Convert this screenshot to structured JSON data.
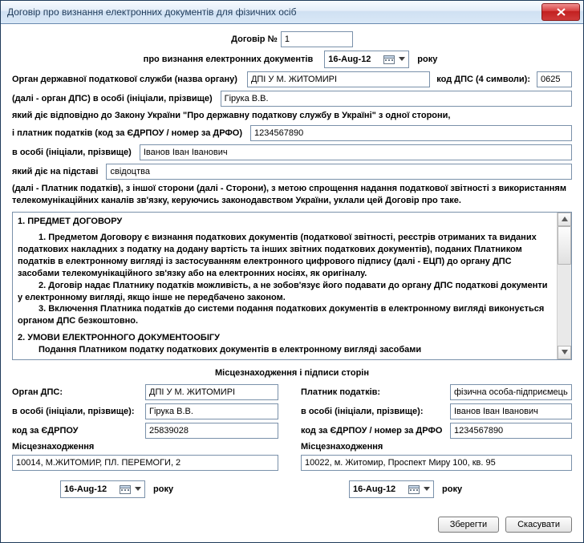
{
  "window": {
    "title": "Договір про визнання електронних документів для фізичних осіб"
  },
  "header": {
    "contract_label": "Договір №",
    "contract_no": "1",
    "subtitle": "про визнання електронних документів",
    "date": "16-Aug-12",
    "year_label": "року"
  },
  "preamble": {
    "organ_label": "Орган державної податкової служби (назва органу)",
    "organ_value": "ДПІ У М. ЖИТОМИРІ",
    "dps_code_label": "код ДПС (4 символи):",
    "dps_code_value": "0625",
    "inperson_label": "(далі - орган ДПС) в особі (ініціали, прізвище)",
    "inperson_value": "Гірука В.В.",
    "law_line": "який діє відповідно до Закону України \"Про державну податкову службу в Україні\" з одної сторони,",
    "payer_code_label": "і платник податків (код за ЄДРПОУ / номер за ДРФО)",
    "payer_code_value": "1234567890",
    "payer_person_label": "в особі (ініціали, прізвище)",
    "payer_person_value": "Іванов Іван Іванович",
    "basis_label": "який діє на підставі",
    "basis_value": "свідоцтва",
    "closing": "(далі - Платник податків), з іншої сторони (далі - Сторони), з метою спрощення надання податкової звітності з використанням телекомунікаційних каналів зв'язку, керуючись законодавством України, уклали цей Договір про таке."
  },
  "scroll": {
    "s1_title": "1. ПРЕДМЕТ ДОГОВОРУ",
    "p1": "1. Предметом Договору є визнання податкових документів (податкової звітності, реєстрів отриманих та виданих податкових накладних з податку на додану вартість та інших звітних податкових документів), поданих Платником податків в електронному вигляді із застосуванням електронного цифрового підпису (далі - ЕЦП) до органу ДПС засобами телекомунікаційного зв'язку або на електронних носіях, як оригіналу.",
    "p2": "2. Договір надає Платнику податків можливість, а не зобов'язує його подавати до органу ДПС податкові документи у електронному вигляді, якщо інше не передбачено законом.",
    "p3": "3. Включення Платника податків до системи подання податкових документів в електронному вигляді виконується органом ДПС безкоштовно.",
    "s2_title": "2. УМОВИ ЕЛЕКТРОННОГО ДОКУМЕНТООБІГУ",
    "p4": "Подання Платником податку податкових документів в електронному вигляді засобами"
  },
  "sig": {
    "title": "Місцезнаходження і підписи сторін",
    "left": {
      "organ_label": "Орган ДПС:",
      "organ_value": "ДПІ У М. ЖИТОМИРІ",
      "person_label": "в особі (ініціали, прізвище):",
      "person_value": "Гірука В.В.",
      "code_label": "код за ЄДРПОУ",
      "code_value": "25839028",
      "addr_label": "Місцезнаходження",
      "addr_value": "10014, М.ЖИТОМИР, ПЛ. ПЕРЕМОГИ, 2",
      "date": "16-Aug-12",
      "year": "року"
    },
    "right": {
      "payer_label": "Платник податків:",
      "payer_value": "фізична особа-підприємець",
      "person_label": "в особі (ініціали, прізвище):",
      "person_value": "Іванов Іван Іванович",
      "code_label": "код за ЄДРПОУ / номер за ДРФО",
      "code_value": "1234567890",
      "addr_label": "Місцезнаходження",
      "addr_value": "10022, м. Житомир, Проспект Миру 100, кв. 95",
      "date": "16-Aug-12",
      "year": "року"
    }
  },
  "buttons": {
    "save": "Зберегти",
    "cancel": "Скасувати"
  }
}
